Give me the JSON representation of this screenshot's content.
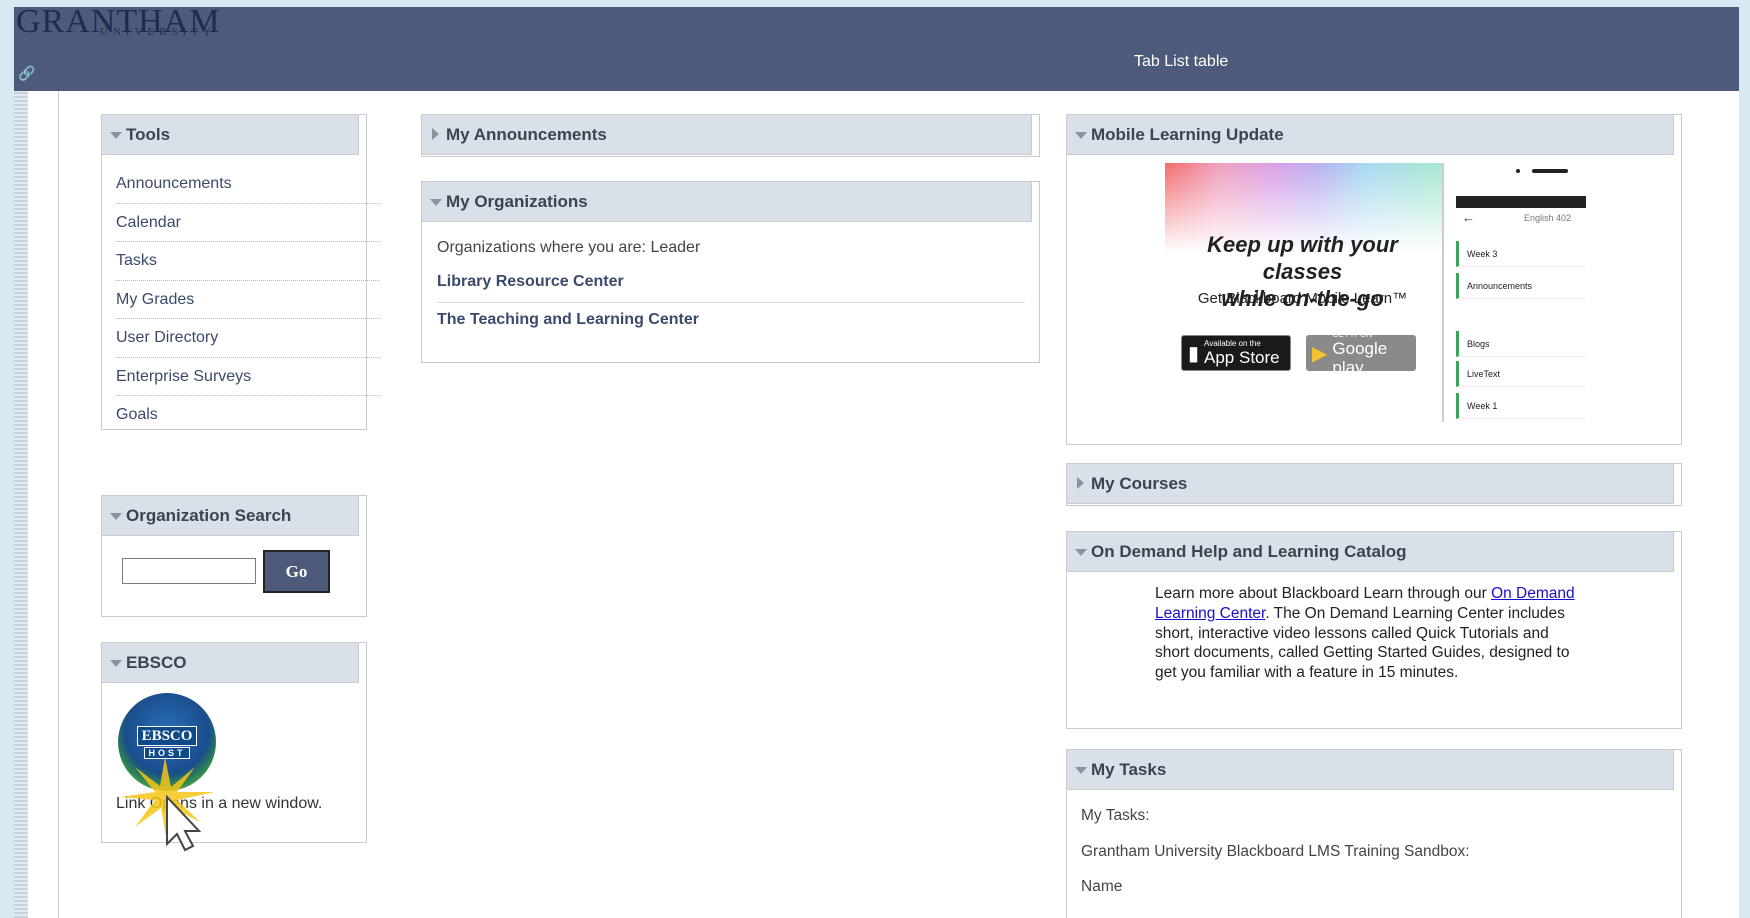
{
  "header": {
    "logo_main": "GRANTHAM",
    "logo_sub": "UNIVERSITY",
    "tab_list_label": "Tab List table"
  },
  "tools": {
    "title": "Tools",
    "items": [
      "Announcements",
      "Calendar",
      "Tasks",
      "My Grades",
      "User Directory",
      "Enterprise Surveys",
      "Goals"
    ]
  },
  "org_search": {
    "title": "Organization Search",
    "input_value": "",
    "go_label": "Go"
  },
  "ebsco": {
    "title": "EBSCO",
    "logo_text": "EBSCO",
    "logo_host": "HOST",
    "link_text": "Link Opens in a new window."
  },
  "announcements": {
    "title": "My Announcements"
  },
  "organizations": {
    "title": "My Organizations",
    "role_line": "Organizations where you are: Leader",
    "links": [
      "Library Resource Center",
      "The Teaching and Learning Center"
    ]
  },
  "mobile": {
    "title": "Mobile Learning Update",
    "headline_1": "Keep up with your classes",
    "headline_2": "while on-the-go",
    "subline": "Get Blackboard Mobile Learn™",
    "appstore_small": "Available on the",
    "appstore_big": "App Store",
    "google_small": "GET IT ON",
    "google_big": "Google play",
    "phone_course": "English 402",
    "phone_rows": [
      "Week 3",
      "Announcements",
      "Blogs",
      "LiveText",
      "Week 1"
    ]
  },
  "courses": {
    "title": "My Courses"
  },
  "ondemand": {
    "title": "On Demand Help and Learning Catalog",
    "text_before": "Learn more about Blackboard Learn through our ",
    "link": "On Demand Learning Center",
    "text_after": ". The On Demand Learning Center includes short, interactive video lessons called Quick Tutorials and short documents, called Getting Started Guides, designed to get you familiar with a feature in 15 minutes."
  },
  "tasks": {
    "title": "My Tasks",
    "line1": "My Tasks:",
    "line2": "Grantham University Blackboard LMS Training Sandbox:",
    "line3": "Name"
  },
  "colors": {
    "header_bar": "#4d5a7a",
    "module_header": "#d9e0e8",
    "link": "#3b4a6b",
    "page_bg": "#d9e9f3"
  }
}
